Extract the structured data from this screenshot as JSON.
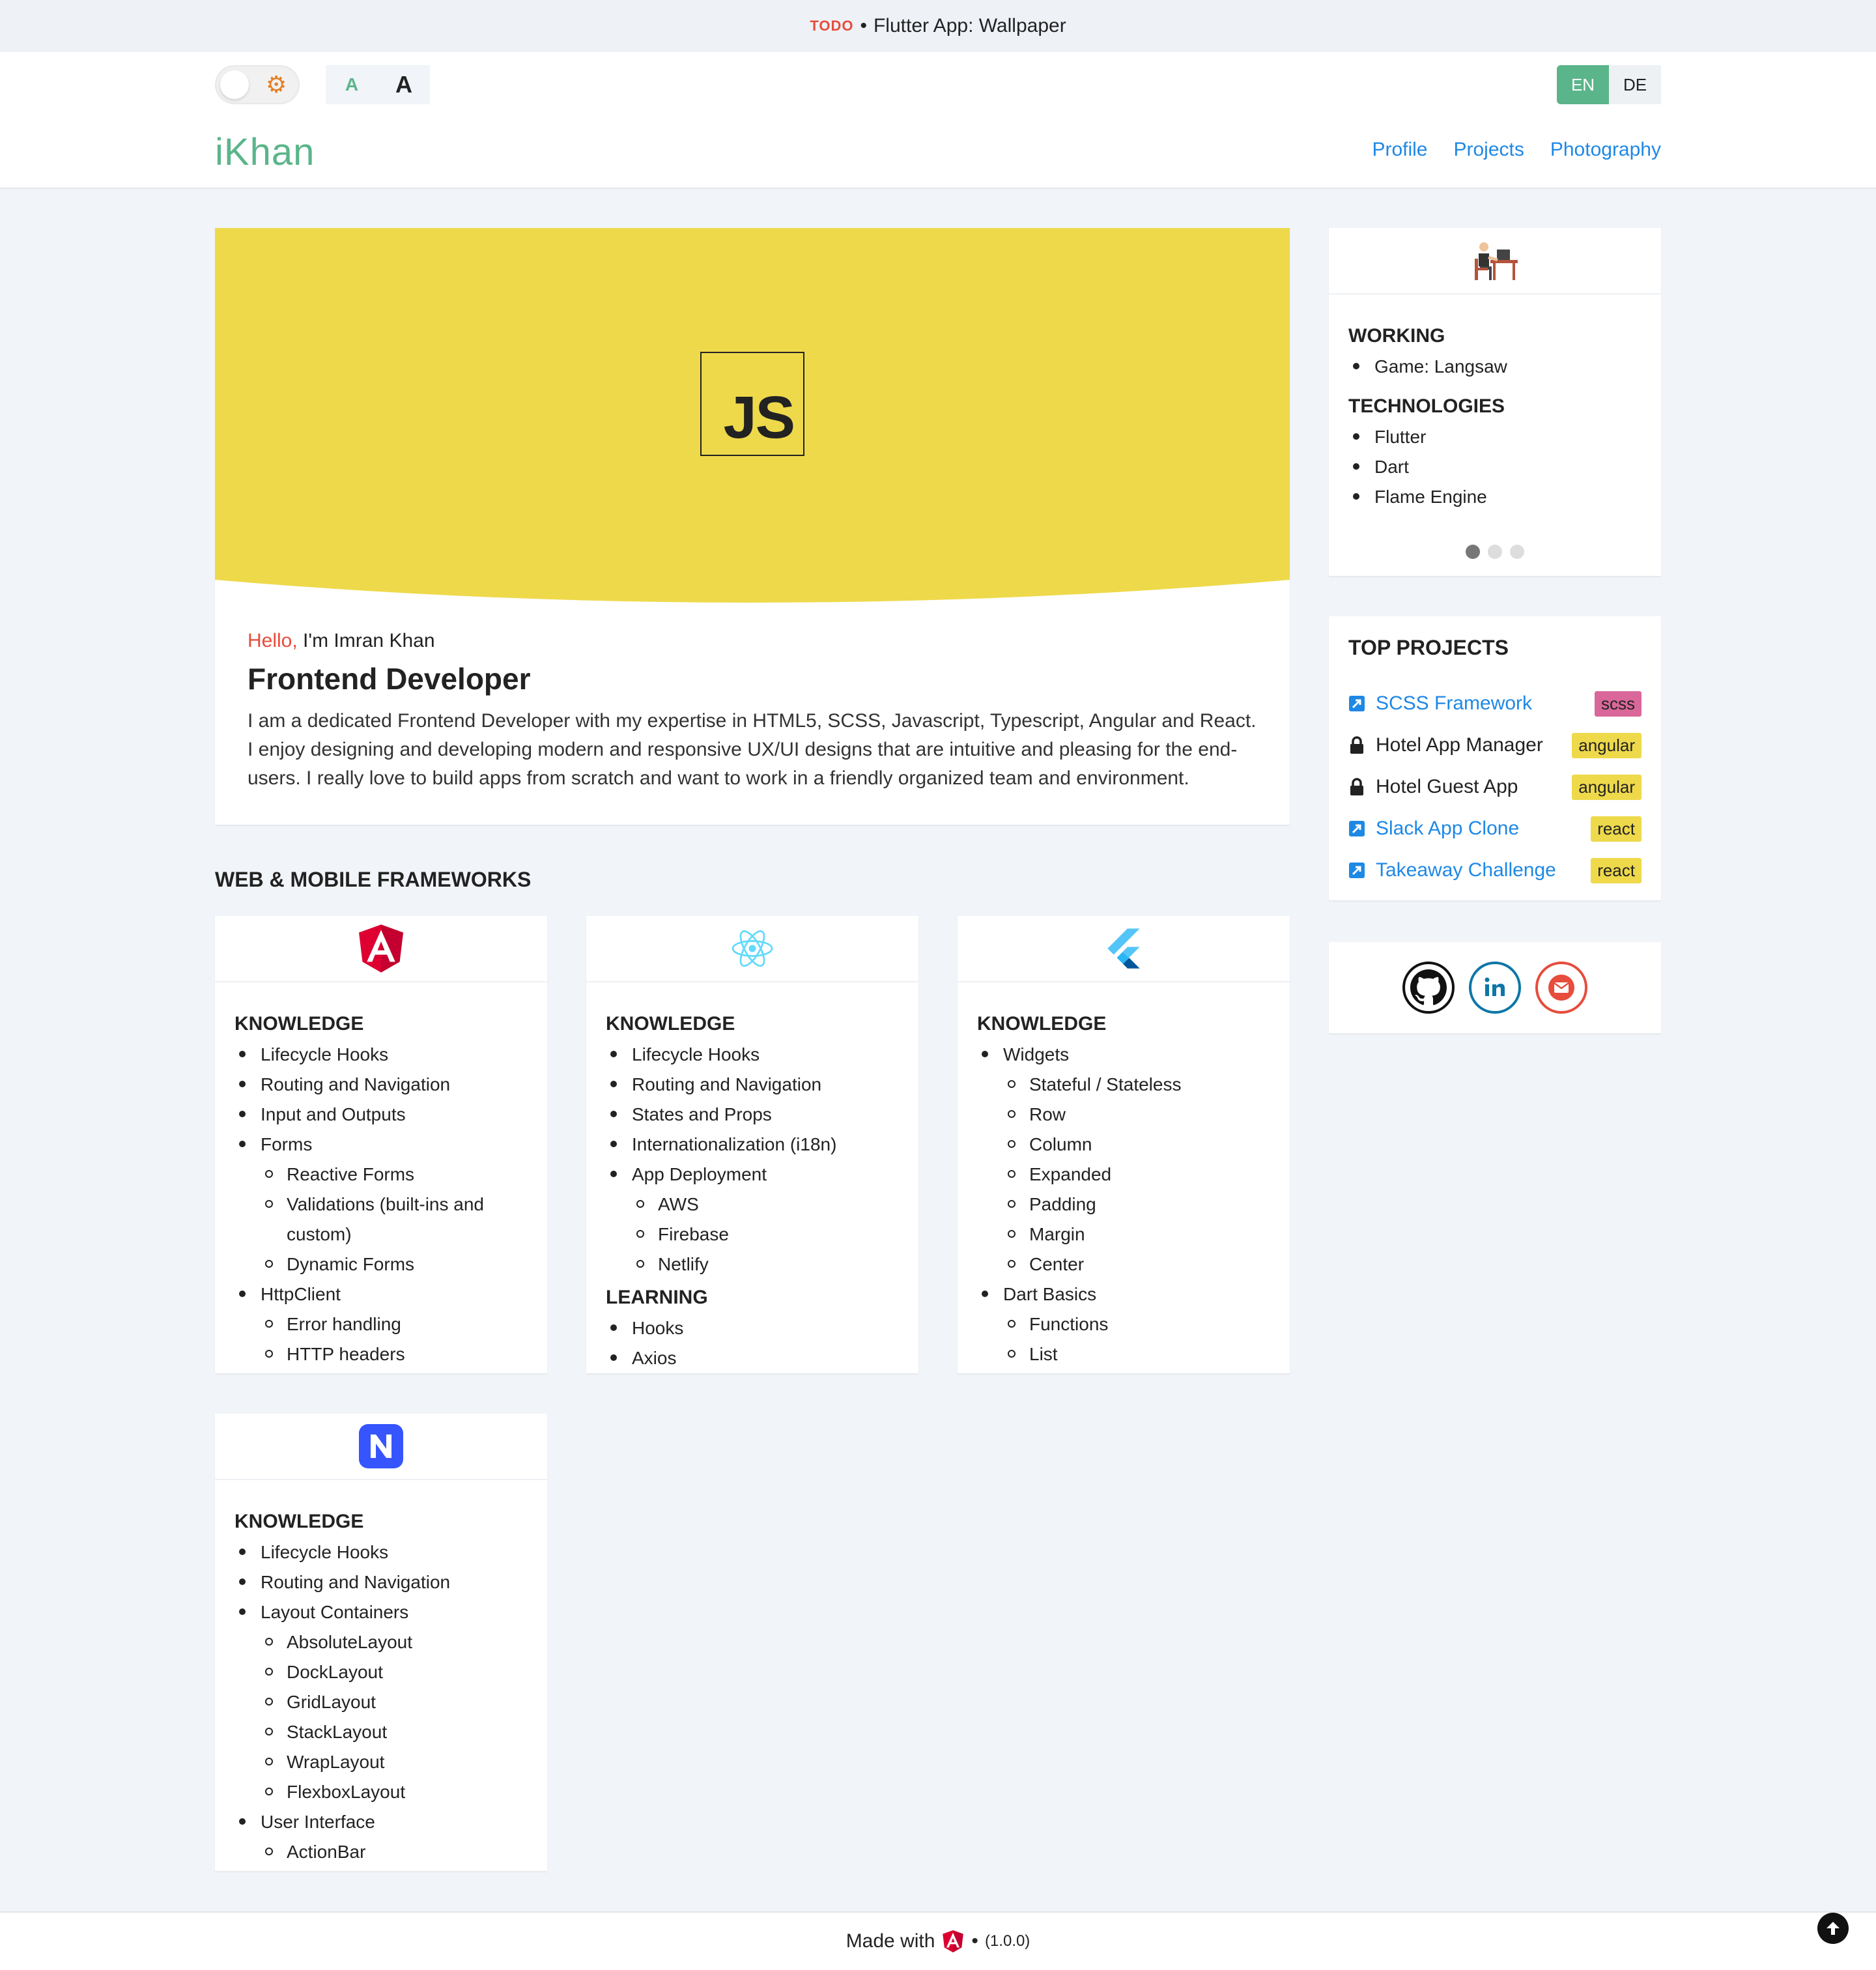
{
  "topbar": {
    "todo": "TODO",
    "separator": "•",
    "text": "Flutter App: Wallpaper"
  },
  "header": {
    "font_small": "A",
    "font_large": "A",
    "lang": [
      "EN",
      "DE"
    ],
    "logo": "iKhan",
    "nav": [
      "Profile",
      "Projects",
      "Photography"
    ]
  },
  "hero": {
    "badge": "JS",
    "banner_color": "#eed94b",
    "greeting": "Hello,",
    "name": "I'm Imran Khan",
    "role": "Frontend Developer",
    "bio": "I am a dedicated Frontend Developer with my expertise in HTML5, SCSS, Javascript, Typescript, Angular and React. I enjoy designing and developing modern and responsive UX/UI designs that are intuitive and pleasing for the end-users. I really love to build apps from scratch and want to work in a friendly organized team and environment."
  },
  "frameworks": {
    "title": "WEB & MOBILE FRAMEWORKS",
    "angular": {
      "icon": "angular-icon",
      "heading": "KNOWLEDGE",
      "items": [
        {
          "label": "Lifecycle Hooks"
        },
        {
          "label": "Routing and Navigation"
        },
        {
          "label": "Input and Outputs"
        },
        {
          "label": "Forms",
          "sub": [
            "Reactive Forms",
            "Validations (built-ins and custom)",
            "Dynamic Forms"
          ]
        },
        {
          "label": "HttpClient",
          "sub": [
            "Error handling",
            "HTTP headers"
          ]
        }
      ]
    },
    "react": {
      "icon": "react-icon",
      "heading": "KNOWLEDGE",
      "items": [
        {
          "label": "Lifecycle Hooks"
        },
        {
          "label": "Routing and Navigation"
        },
        {
          "label": "States and Props"
        },
        {
          "label": "Internationalization (i18n)"
        },
        {
          "label": "App Deployment",
          "sub": [
            "AWS",
            "Firebase",
            "Netlify"
          ]
        }
      ],
      "heading2": "LEARNING",
      "items2": [
        "Hooks",
        "Axios"
      ]
    },
    "flutter": {
      "icon": "flutter-icon",
      "heading": "KNOWLEDGE",
      "items": [
        {
          "label": "Widgets",
          "sub": [
            "Stateful / Stateless",
            "Row",
            "Column",
            "Expanded",
            "Padding",
            "Margin",
            "Center"
          ]
        },
        {
          "label": "Dart Basics",
          "sub": [
            "Functions",
            "List"
          ]
        }
      ]
    },
    "nativescript": {
      "icon": "nativescript-icon",
      "heading": "KNOWLEDGE",
      "items": [
        {
          "label": "Lifecycle Hooks"
        },
        {
          "label": "Routing and Navigation"
        },
        {
          "label": "Layout Containers",
          "sub": [
            "AbsoluteLayout",
            "DockLayout",
            "GridLayout",
            "StackLayout",
            "WrapLayout",
            "FlexboxLayout"
          ]
        },
        {
          "label": "User Interface",
          "sub": [
            "ActionBar"
          ]
        }
      ]
    }
  },
  "working": {
    "icon": "developer-at-desk-icon",
    "heading": "WORKING",
    "items": [
      "Game: Langsaw"
    ],
    "heading2": "TECHNOLOGIES",
    "items2": [
      "Flutter",
      "Dart",
      "Flame Engine"
    ],
    "carousel_pages": 3,
    "carousel_active": 1
  },
  "top_projects": {
    "title": "TOP PROJECTS",
    "items": [
      {
        "name": "SCSS Framework",
        "tag": "scss",
        "access": "link"
      },
      {
        "name": "Hotel App Manager",
        "tag": "angular",
        "access": "locked"
      },
      {
        "name": "Hotel Guest App",
        "tag": "angular",
        "access": "locked"
      },
      {
        "name": "Slack App Clone",
        "tag": "react",
        "access": "link"
      },
      {
        "name": "Takeaway Challenge",
        "tag": "react",
        "access": "link"
      }
    ]
  },
  "social": [
    "github-icon",
    "linkedin-icon",
    "email-icon"
  ],
  "footer": {
    "made_with": "Made with",
    "separator": "•",
    "version": "(1.0.0)"
  },
  "colors": {
    "accent": "#5bb58a",
    "link": "#1e88e5",
    "highlight": "#e74c3c",
    "banner": "#eed94b",
    "scss_tag": "#d9679a"
  }
}
